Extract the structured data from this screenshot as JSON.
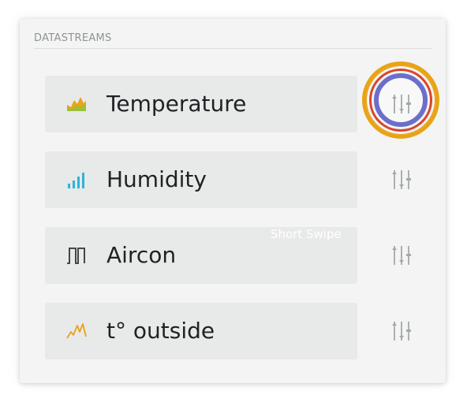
{
  "section": {
    "title": "DATASTREAMS"
  },
  "datastreams": [
    {
      "label": "Temperature",
      "icon": "area-chart-icon",
      "icon_color": "#e8a317",
      "icon_color_2": "#9bbf3b"
    },
    {
      "label": "Humidity",
      "icon": "bar-chart-icon",
      "icon_color": "#2bb5d8"
    },
    {
      "label": "Aircon",
      "icon": "square-wave-icon",
      "icon_color": "#333333"
    },
    {
      "label": "t° outside",
      "icon": "line-chart-icon",
      "icon_color": "#e8a317"
    }
  ],
  "gesture_hint": "Short Swipe",
  "colors": {
    "panel_bg": "#f4f4f4",
    "row_bg": "#e8e9e9",
    "settings_icon": "#a3a8aa",
    "highlight_outer": "#e8a317",
    "highlight_mid": "#d8452a",
    "highlight_inner": "#6b6fc9"
  }
}
